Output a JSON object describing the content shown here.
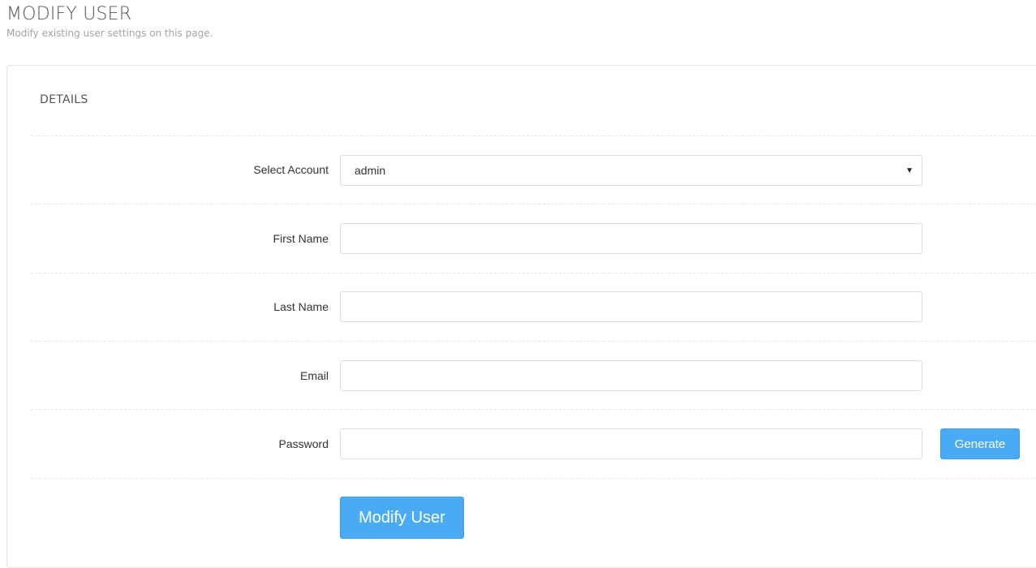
{
  "header": {
    "title": "MODIFY USER",
    "subtitle": "Modify existing user settings on this page."
  },
  "panel": {
    "heading": "DETAILS"
  },
  "form": {
    "account": {
      "label": "Select Account",
      "selected": "admin"
    },
    "first_name": {
      "label": "First Name",
      "value": ""
    },
    "last_name": {
      "label": "Last Name",
      "value": ""
    },
    "email": {
      "label": "Email",
      "value": ""
    },
    "password": {
      "label": "Password",
      "value": "",
      "generate_label": "Generate"
    },
    "submit_label": "Modify User"
  },
  "colors": {
    "accent": "#4aabf5",
    "border": "#dcdcdc"
  }
}
